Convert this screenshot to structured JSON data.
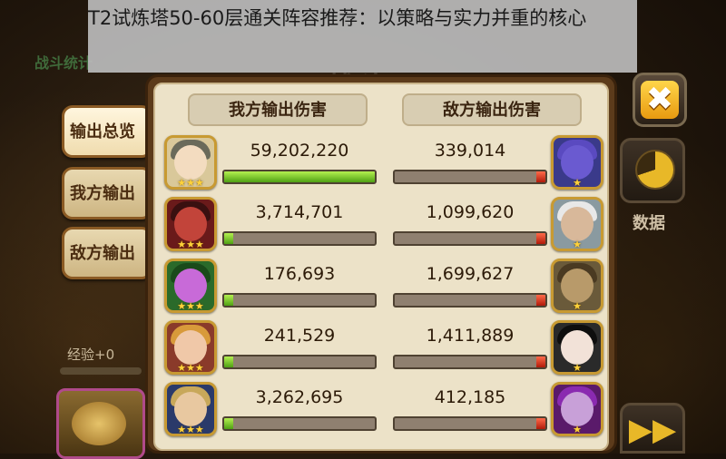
{
  "overlay": {
    "caption": "T2试炼塔50-60层通关阵容推荐：以策略与实力并重的核心"
  },
  "background": {
    "title": "战斗统计",
    "watermark": "战斗"
  },
  "tabs": [
    {
      "label": "输出总览",
      "active": true
    },
    {
      "label": "我方输出",
      "active": false
    },
    {
      "label": "敌方输出",
      "active": false
    }
  ],
  "experience": "经验+0",
  "headers": {
    "ours": "我方输出伤害",
    "enemy": "敌方输出伤害"
  },
  "rows": [
    {
      "our_damage": "59,202,220",
      "our_ratio": 1.0,
      "enemy_damage": "339,014",
      "enemy_ratio": 0.0
    },
    {
      "our_damage": "3,714,701",
      "our_ratio": 0.063,
      "enemy_damage": "1,099,620",
      "enemy_ratio": 0.02
    },
    {
      "our_damage": "176,693",
      "our_ratio": 0.0,
      "enemy_damage": "1,699,627",
      "enemy_ratio": 0.03
    },
    {
      "our_damage": "241,529",
      "our_ratio": 0.0,
      "enemy_damage": "1,411,889",
      "enemy_ratio": 0.02
    },
    {
      "our_damage": "3,262,695",
      "our_ratio": 0.055,
      "enemy_damage": "412,185",
      "enemy_ratio": 0.0
    }
  ],
  "stars": {
    "ours": [
      "★★★",
      "★★★",
      "★★★",
      "★★★",
      "★★★"
    ],
    "enemy": [
      "★",
      "★",
      "★",
      "★",
      "★"
    ]
  },
  "buttons": {
    "close": "✖",
    "data_label": "数据",
    "next": "▶▶"
  },
  "colors": {
    "our_bar": "#7cd22e",
    "enemy_bar": "#d8301a"
  }
}
